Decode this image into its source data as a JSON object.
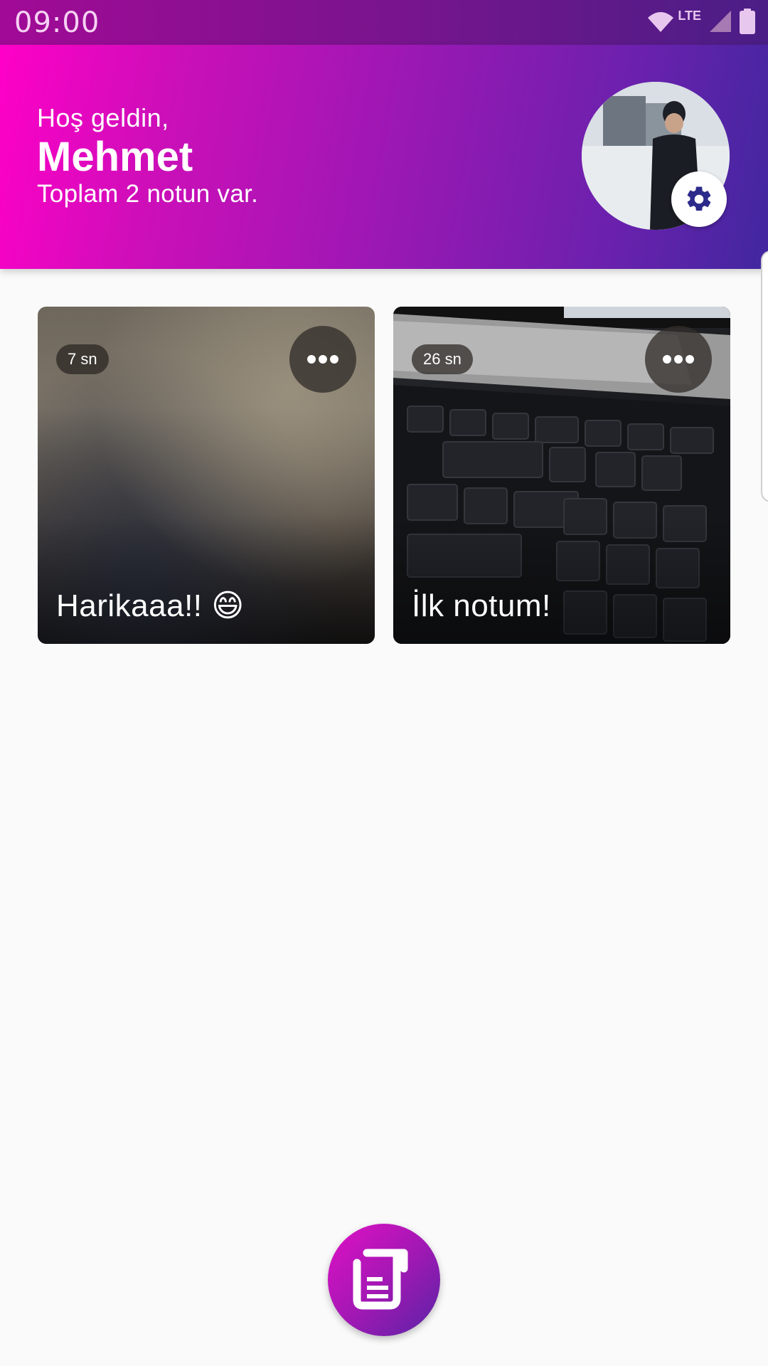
{
  "status_bar": {
    "time": "09:00",
    "network": "LTE",
    "icons": [
      "wifi-icon",
      "signal-icon",
      "battery-icon"
    ]
  },
  "header": {
    "greeting": "Hoş geldin,",
    "user_name": "Mehmet",
    "note_count_text": "Toplam 2 notun var.",
    "avatar": "profile-photo",
    "settings_icon": "gear-icon"
  },
  "notes": [
    {
      "title": "Harikaaa!! 😄",
      "duration": "7 sn",
      "more_icon": "more-horizontal-icon"
    },
    {
      "title": "İlk notum!",
      "duration": "26 sn",
      "more_icon": "more-horizontal-icon"
    }
  ],
  "fab": {
    "icon": "note-icon"
  },
  "colors": {
    "header_gradient_start": "#ff00c8",
    "header_gradient_end": "#4127a0",
    "accent_dark": "#3a2a8c",
    "background": "#fafafa"
  }
}
